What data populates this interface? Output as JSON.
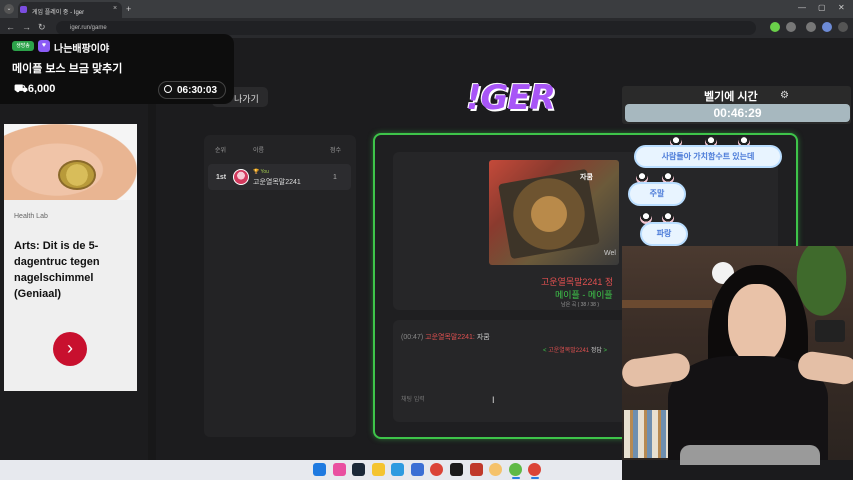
{
  "browser": {
    "tab_title": "게임 플레이 중 - Iger",
    "tab_close": "×",
    "tab_new": "+",
    "url": "iger.run/game",
    "nav_back": "←",
    "nav_forward": "→",
    "nav_reload": "↻",
    "window_controls": [
      "—",
      "▢",
      "✕"
    ],
    "menu": "⌄"
  },
  "page": {
    "logo": "!GER",
    "back_button": "나가기"
  },
  "scoreboard": {
    "headers": {
      "rank": "순위",
      "name": "이름",
      "score": "점수"
    },
    "rows": [
      {
        "rank": "1st",
        "badge": "🏆 You",
        "name": "고운열목말2241",
        "score": "1"
      }
    ]
  },
  "game": {
    "card_tag": "자쿰",
    "card_caption": "Wel",
    "answer_line": "고운열목말2241 정",
    "answer_line2": "메이플 - 메이플",
    "answer_progress": "남은 곡 ( 38 / 38 )",
    "chat": [
      {
        "time": "(00:47)",
        "name": "고운열목말2241:",
        "text": "자쿰"
      },
      {
        "prefix": "<",
        "name": "고운열목말2241",
        "text": "정답",
        "suffix": ">"
      }
    ],
    "input_placeholder": "채팅 입력"
  },
  "ad": {
    "source": "Health Lab",
    "title": "Arts: Dit is de 5-dagentruc tegen nagelschimmel (Geniaal)",
    "button": "›"
  },
  "stream_overlay": {
    "live_badge": "생방송",
    "heart": "♥",
    "streamer": "나는배팡이야",
    "title": "메이플 보스 브금 맞추기",
    "viewers": "6,000",
    "viewer_icon": "⛟",
    "timer": "06:30:03"
  },
  "right_overlay": {
    "title": "벨기에 시간",
    "gear": "⚙",
    "time": "00:46:29",
    "bubbles": [
      "사람들아 가치함수트 있는데",
      "주말",
      "파랑"
    ]
  },
  "colors": {
    "accent_green": "#3ec44a",
    "logo_purple": "#a855f7",
    "ad_red": "#c8102e"
  }
}
